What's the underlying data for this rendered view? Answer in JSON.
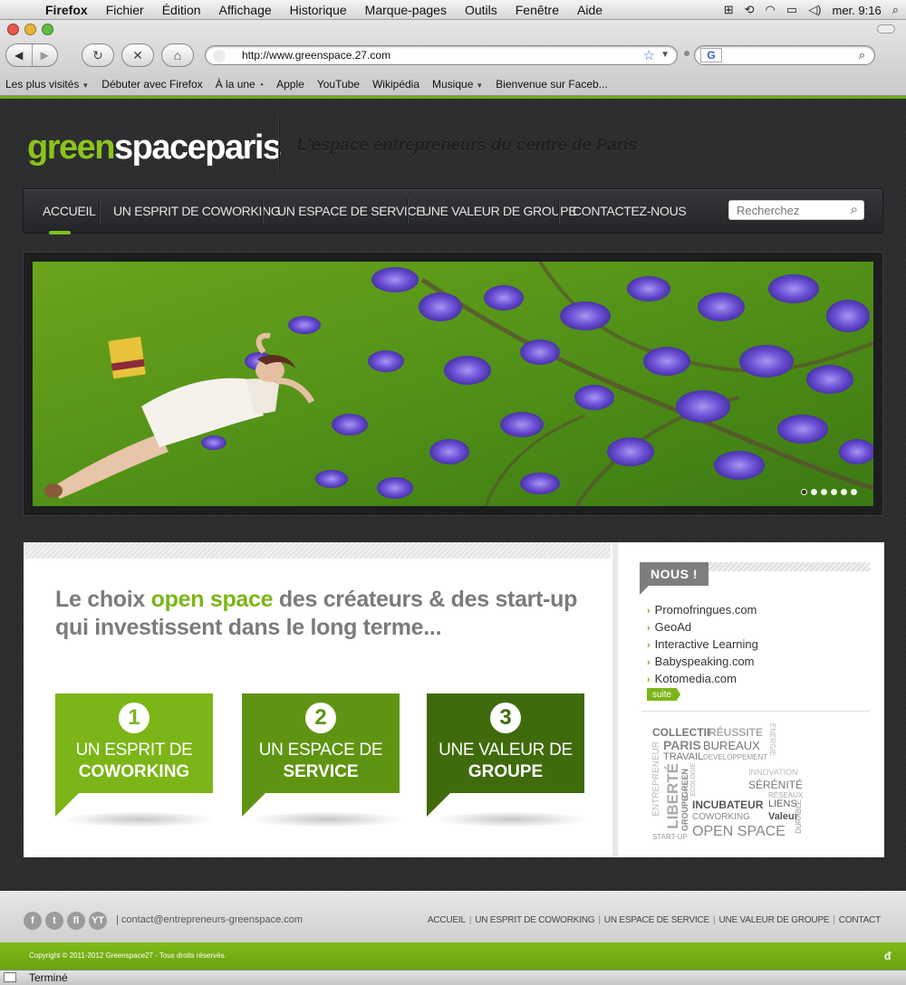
{
  "menubar": {
    "app": "Firefox",
    "items": [
      "Fichier",
      "Édition",
      "Affichage",
      "Historique",
      "Marque-pages",
      "Outils",
      "Fenêtre",
      "Aide"
    ],
    "clock": "mer. 9:16"
  },
  "browser": {
    "url": "http://www.greenspace.27.com",
    "search_engine_icon": "G",
    "bookmarks": [
      {
        "label": "Les plus visités",
        "has_menu": true
      },
      {
        "label": "Débuter avec Firefox",
        "has_menu": false
      },
      {
        "label": "À la une",
        "has_menu": false,
        "icon": "rss-icon"
      },
      {
        "label": "Apple",
        "has_menu": false
      },
      {
        "label": "YouTube",
        "has_menu": false
      },
      {
        "label": "Wikipédia",
        "has_menu": false
      },
      {
        "label": "Musique",
        "has_menu": true
      },
      {
        "label": "Bienvenue sur Faceb...",
        "has_menu": false
      }
    ],
    "status": "Terminé"
  },
  "site": {
    "logo": {
      "part1": "green",
      "part2": "spaceparis"
    },
    "tagline": "L'espace entrepreneurs du centre de Paris",
    "nav": [
      "ACCUEIL",
      "UN ESPRIT DE COWORKING",
      "UN ESPACE DE SERVICE",
      "UNE VALEUR DE GROUPE",
      "CONTACTEZ-NOUS"
    ],
    "active_nav": "ACCUEIL",
    "search_placeholder": "Recherchez",
    "slider_dots": 6,
    "headline": {
      "before": "Le choix ",
      "highlight": "open space",
      "after": " des créateurs & des start-up qui investissent dans le long terme..."
    },
    "cards": [
      {
        "number": "1",
        "line1": "UN ESPRIT DE",
        "line2": "COWORKING",
        "color": "#7cb517"
      },
      {
        "number": "2",
        "line1": "UN ESPACE DE",
        "line2": "SERVICE",
        "color": "#5f9412"
      },
      {
        "number": "3",
        "line1": "UNE VALEUR DE",
        "line2": "GROUPE",
        "color": "#3f6b0c"
      }
    ],
    "sidebar": {
      "badge": "NOUS !",
      "links": [
        "Promofringues.com",
        "GeoAd",
        "Interactive Learning",
        "Babyspeaking.com",
        "Kotomedia.com"
      ],
      "more": "suite",
      "cloud": [
        {
          "text": "COLLECTIF"
        },
        {
          "text": "RÉUSSITE"
        },
        {
          "text": "ÉNERGIE"
        },
        {
          "text": "PARIS"
        },
        {
          "text": "BUREAUX"
        },
        {
          "text": "TRAVAIL"
        },
        {
          "text": "DEVELOPPEMENT"
        },
        {
          "text": "ENTREPRENEUR"
        },
        {
          "text": "LIBERTÉ"
        },
        {
          "text": "ECOLOGIE"
        },
        {
          "text": "GREEN"
        },
        {
          "text": "GROUPE"
        },
        {
          "text": "INNOVATION"
        },
        {
          "text": "SÉRÉNITÉ"
        },
        {
          "text": "RÉSEAUX"
        },
        {
          "text": "INCUBATEUR"
        },
        {
          "text": "LIENS"
        },
        {
          "text": "COWORKING"
        },
        {
          "text": "Valeur"
        },
        {
          "text": "DURABLE"
        },
        {
          "text": "START-UP"
        },
        {
          "text": "OPEN SPACE"
        }
      ]
    },
    "footer": {
      "social": [
        "f",
        "t",
        "fl",
        "YT"
      ],
      "email": "| contact@entrepreneurs-greenspace.com",
      "links": [
        "ACCUEIL",
        "UN ESPRIT DE COWORKING",
        "UN ESPACE DE SERVICE",
        "UNE VALEUR DE GROUPE",
        "CONTACT"
      ],
      "copyright": "Copyright © 2011-2012 Greenspace27 - Tous droits réservés."
    },
    "colors": {
      "brand_green": "#7cb517",
      "dark_bg": "#2b2c2e"
    }
  }
}
